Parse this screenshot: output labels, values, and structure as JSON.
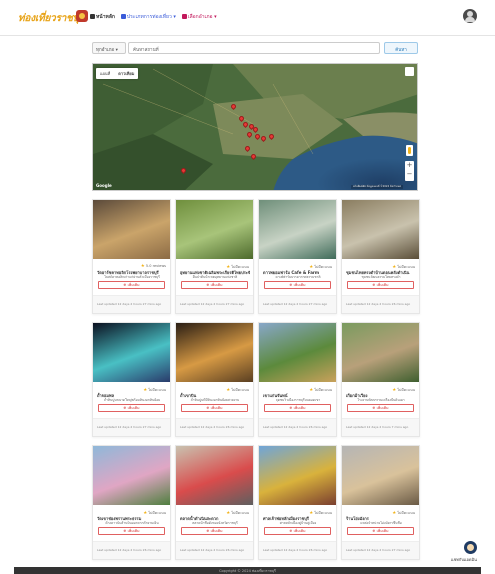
{
  "nav": {
    "brand": "ท่องเที่ยวราชบุรี",
    "home": "หน้าหลัก",
    "menu1": "ประเภทการท่องเที่ยว",
    "menu2": "เลือกอำเภอ"
  },
  "search": {
    "province": "ทุกอำเภอ",
    "placeholder": "ค้นหาสถานที่",
    "button": "ค้นหา"
  },
  "map": {
    "tab_map": "แผนที่",
    "tab_satellite": "ดาวเทียม",
    "google": "Google",
    "attribution": "แป้นพิมพ์ลัด  ข้อมูลแผนที่ ©2024  ข้อกำหนด",
    "marker_count": 12
  },
  "cards": [
    {
      "title": "วัดอาร์ชคาทอลิกโรงพยาบาลราชบุรี",
      "desc": "โบสถ์คาทอลิกเก่าแก่ย่านตัวเมืองราชบุรี",
      "rating": "5.0 reviews",
      "button": "เพิ่มเติม",
      "updated": "Last updated 12 days 2 hours 27 mins ago"
    },
    {
      "title": "อุทยานแห่งชาติเฉลิมพระเกียรติไทยประจัน",
      "desc": "ผืนป่าต้นน้ำเขตอุทยานแห่งชาติ",
      "rating": "ไม่มีคะแนน",
      "button": "เพิ่มเติม",
      "updated": "Last updated 12 days 2 hours 27 mins ago"
    },
    {
      "title": "ดาวพยอมฟาร์ม Cafe & Farm",
      "desc": "คาเฟ่ฟาร์มบรรยากาศธรรมชาติ",
      "rating": "ไม่มีคะแนน",
      "button": "เพิ่มเติม",
      "updated": "Last updated 12 days 2 hours 27 mins ago"
    },
    {
      "title": "ชุมชนไทยทรงดำบ้านดอนคลังดำเนิน",
      "desc": "ชุมชนวัฒนธรรมไทยทรงดำ",
      "rating": "ไม่มีคะแนน",
      "button": "เพิ่มเติม",
      "updated": "Last updated 12 days 2 hours 26 mins ago"
    },
    {
      "title": "ถ้ำจอมพล",
      "desc": "ถ้ำหินปูนขนาดใหญ่พร้อมหินงอกหินย้อย",
      "rating": "ไม่มีคะแนน",
      "button": "เพิ่มเติม",
      "updated": "Last updated 12 days 2 hours 27 mins ago"
    },
    {
      "title": "ถ้ำเขาบิน",
      "desc": "ถ้ำหินปูนที่มีหินงอกหินย้อยสวยงาม",
      "rating": "ไม่มีคะแนน",
      "button": "เพิ่มเติม",
      "updated": "Last updated 12 days 2 hours 26 mins ago"
    },
    {
      "title": "เขาแก่นจันทน์",
      "desc": "จุดชมวิวเมืองราชบุรีบนยอดเขา",
      "rating": "ไม่มีคะแนน",
      "button": "เพิ่มเติม",
      "updated": "Last updated 12 days 2 hours 26 mins ago"
    },
    {
      "title": "เกือกม้าเวียง",
      "desc": "โรงงานหัตถกรรมเครื่องปั้นดินเผา",
      "rating": "ไม่มีคะแนน",
      "button": "เพิ่มเติม",
      "updated": "Last updated 12 days 2 hours 7 mins ago"
    },
    {
      "title": "วัดเขาช่องพรานพระธรรม",
      "desc": "ค้างคาวนับล้านบินออกจากถ้ำยามเย็น",
      "rating": "ไม่มีคะแนน",
      "button": "เพิ่มเติม",
      "updated": "Last updated 12 days 2 hours 26 mins ago"
    },
    {
      "title": "ตลาดน้ำดำเนินสะดวก",
      "desc": "ตลาดน้ำชื่อดังของจังหวัดราชบุรี",
      "rating": "ไม่มีคะแนน",
      "button": "เพิ่มเติม",
      "updated": "Last updated 12 days 2 hours 26 mins ago"
    },
    {
      "title": "ศาลเจ้าพ่อหลักเมืองราชบุรี",
      "desc": "ศาลหลักเมืองคู่บ้านคู่เมือง",
      "rating": "ไม่มีคะแนน",
      "button": "เพิ่มเติม",
      "updated": "Last updated 12 days 2 hours 26 mins ago"
    },
    {
      "title": "ร้านโอ่งมังกร",
      "desc": "แหล่งจำหน่ายโอ่งมังกรขึ้นชื่อ",
      "rating": "ไม่มีคะแนน",
      "button": "เพิ่มเติม",
      "updated": "Last updated 12 days 2 hours 27 mins ago"
    }
  ],
  "chat": {
    "label": "แชทกับแอดมิน"
  },
  "footer": {
    "text": "Copyright © 2024 ท่องเที่ยวราชบุรี"
  }
}
